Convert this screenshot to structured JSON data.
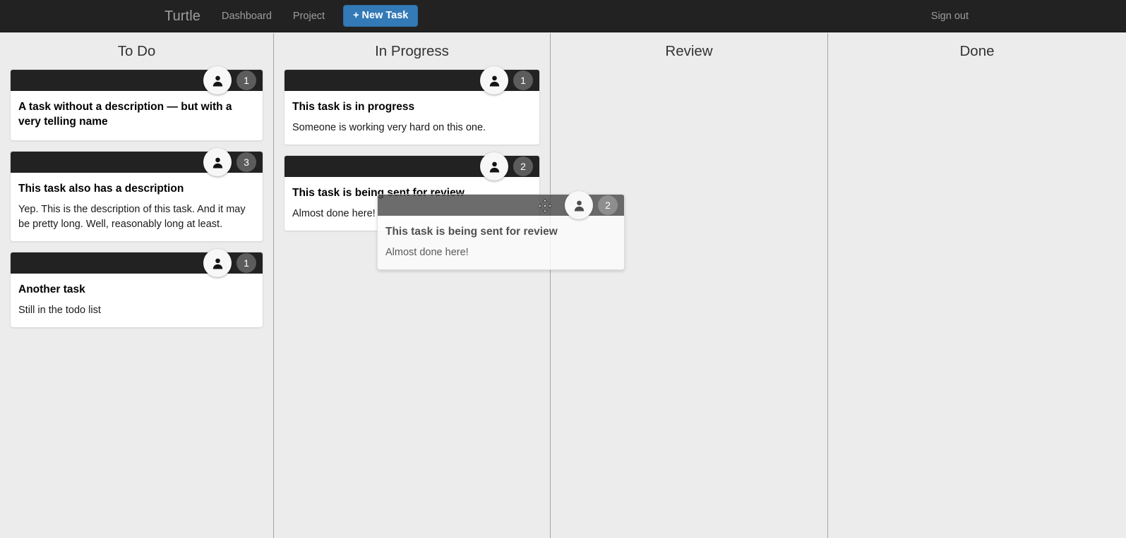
{
  "navbar": {
    "brand": "Turtle",
    "links": [
      {
        "label": "Dashboard",
        "name": "dashboard"
      },
      {
        "label": "Project",
        "name": "project"
      }
    ],
    "new_task_label": "+ New Task",
    "sign_out_label": "Sign out",
    "background_color": "#222222",
    "accent_color": "#337ab7",
    "link_color": "#9d9d9d"
  },
  "board": {
    "background_color": "#ececec",
    "divider_color": "#a6a6a6",
    "card_header_color": "#222222",
    "badge_color": "#5c5c5c",
    "columns": [
      {
        "title": "To Do",
        "cards": [
          {
            "title": "A task without a description — but with a very telling name",
            "description": "",
            "badge": "1",
            "avatar_icon": "person-icon"
          },
          {
            "title": "This task also has a description",
            "description": "Yep. This is the description of this task. And it may be pretty long. Well, reasonably long at least.",
            "badge": "3",
            "avatar_icon": "person-icon"
          },
          {
            "title": "Another task",
            "description": "Still in the todo list",
            "badge": "1",
            "avatar_icon": "person-icon"
          }
        ]
      },
      {
        "title": "In Progress",
        "cards": [
          {
            "title": "This task is in progress",
            "description": "Someone is working very hard on this one.",
            "badge": "1",
            "avatar_icon": "person-icon"
          },
          {
            "title": "This task is being sent for review",
            "description": "Almost done here!",
            "badge": "2",
            "avatar_icon": "person-icon"
          }
        ]
      },
      {
        "title": "Review",
        "cards": []
      },
      {
        "title": "Done",
        "cards": []
      }
    ]
  },
  "drag_ghost": {
    "title": "This task is being sent for review",
    "description": "Almost done here!",
    "badge": "2",
    "avatar_icon": "person-icon",
    "cursor_icon": "move-cursor-icon"
  }
}
